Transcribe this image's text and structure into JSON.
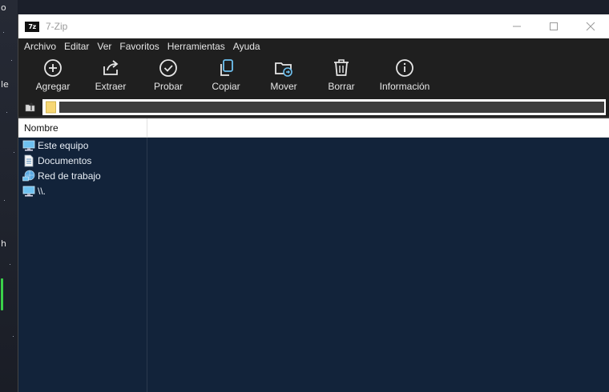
{
  "desktop": {
    "fragments": [
      "o",
      "le",
      "h"
    ]
  },
  "window": {
    "title": "7-Zip",
    "icon_text": "7z",
    "controls": [
      "minimize-icon",
      "maximize-icon",
      "close-icon"
    ]
  },
  "menu": {
    "items": [
      {
        "label": "Archivo"
      },
      {
        "label": "Editar"
      },
      {
        "label": "Ver"
      },
      {
        "label": "Favoritos"
      },
      {
        "label": "Herramientas"
      },
      {
        "label": "Ayuda"
      }
    ]
  },
  "toolbar": {
    "buttons": [
      {
        "label": "Agregar",
        "icon": "plus-circle-icon"
      },
      {
        "label": "Extraer",
        "icon": "share-arrow-icon"
      },
      {
        "label": "Probar",
        "icon": "check-circle-icon"
      },
      {
        "label": "Copiar",
        "icon": "copy-icon"
      },
      {
        "label": "Mover",
        "icon": "folder-move-icon"
      },
      {
        "label": "Borrar",
        "icon": "trash-icon"
      },
      {
        "label": "Información",
        "icon": "info-icon"
      }
    ]
  },
  "address": {
    "value": ""
  },
  "list": {
    "columns": [
      {
        "label": "Nombre"
      }
    ],
    "items": [
      {
        "label": "Este equipo",
        "icon": "computer-icon"
      },
      {
        "label": "Documentos",
        "icon": "document-icon"
      },
      {
        "label": "Red de trabajo",
        "icon": "network-icon"
      },
      {
        "label": "\\\\.",
        "icon": "computer-icon"
      }
    ]
  },
  "colors": {
    "list_background": "#12233a",
    "toolbar_background": "#1f1f1f",
    "accent_icon": "#6ec1f0"
  }
}
